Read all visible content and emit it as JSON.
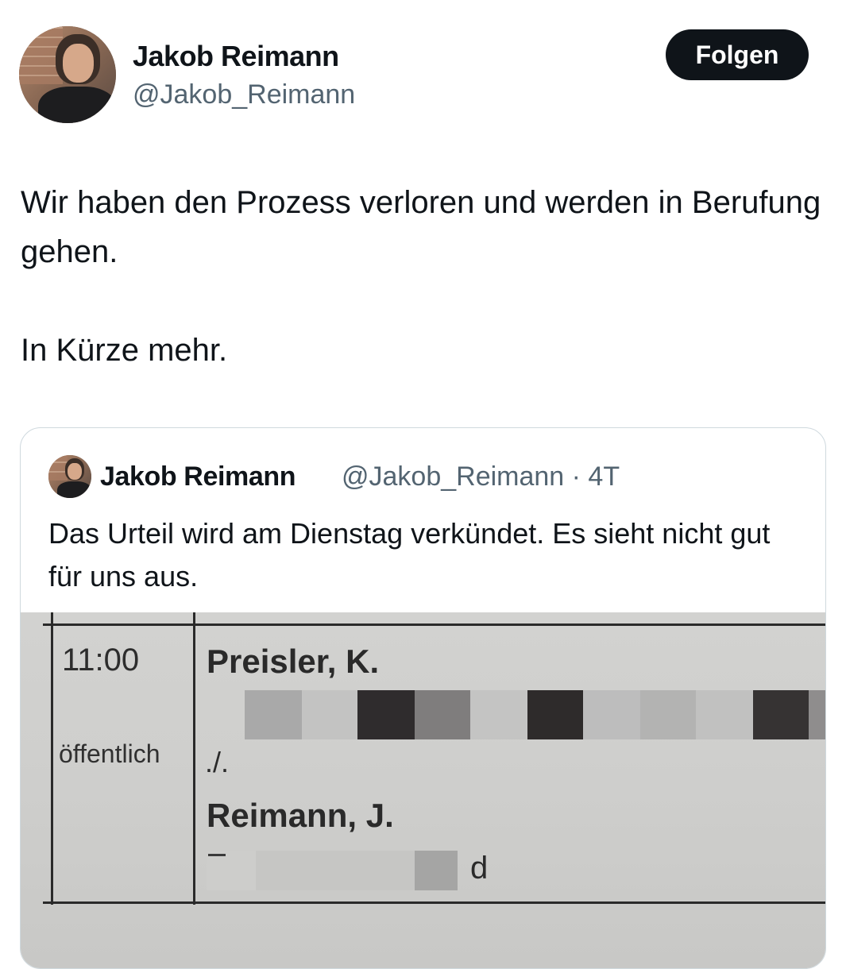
{
  "author": {
    "name": "Jakob Reimann",
    "handle": "@Jakob_Reimann"
  },
  "follow_label": "Folgen",
  "tweet": {
    "line1": "Wir haben den Prozess verloren und werden in Berufung gehen.",
    "line2": "In Kürze mehr."
  },
  "quoted": {
    "name": "Jakob Reimann",
    "meta": "@Jakob_Reimann · 4T",
    "text": "Das Urteil wird am Dienstag verkündet. Es sieht nicht gut für uns aus.",
    "document": {
      "time": "11:00",
      "status": "öffentlich",
      "party1": "Preisler, K.",
      "versus": "./.",
      "party2": "Reimann, J.",
      "fragment": "d"
    }
  },
  "colors": {
    "text": "#0f1419",
    "secondary": "#536471",
    "button_bg": "#0f1419",
    "border": "#cfd9de"
  }
}
